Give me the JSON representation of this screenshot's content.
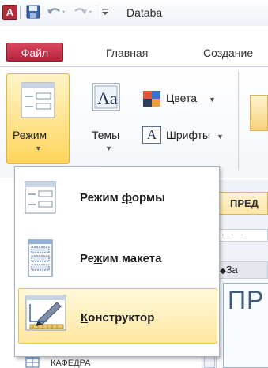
{
  "window": {
    "app_letter": "A",
    "title_fragment": "Databa"
  },
  "ribbon_tabs": {
    "file": "Файл",
    "home": "Главная",
    "create": "Создание"
  },
  "ribbon": {
    "mode_button": "Режим",
    "themes_button": "Темы",
    "colors_button": "Цвета",
    "fonts_button": "Шрифты",
    "fonts_glyph": "A",
    "themes_glyph": "Aa"
  },
  "menu": {
    "items": [
      {
        "pre": "Режим ",
        "accel": "ф",
        "post": "ормы",
        "selected": false
      },
      {
        "pre": "Ре",
        "accel": "ж",
        "post": "им макета",
        "selected": false
      },
      {
        "pre": "",
        "accel": "К",
        "post": "онструктор",
        "selected": true
      }
    ]
  },
  "document": {
    "tab_label": "ПРЕД",
    "ruler_text": "· · ·",
    "section_label": "За",
    "form_title": "ПР"
  },
  "navigation": {
    "item_label": "КАФЕДРА"
  },
  "colors": {
    "file_tab": "#c2334a",
    "selection": "#ffe7a2",
    "app_icon": "#b42d3a"
  }
}
